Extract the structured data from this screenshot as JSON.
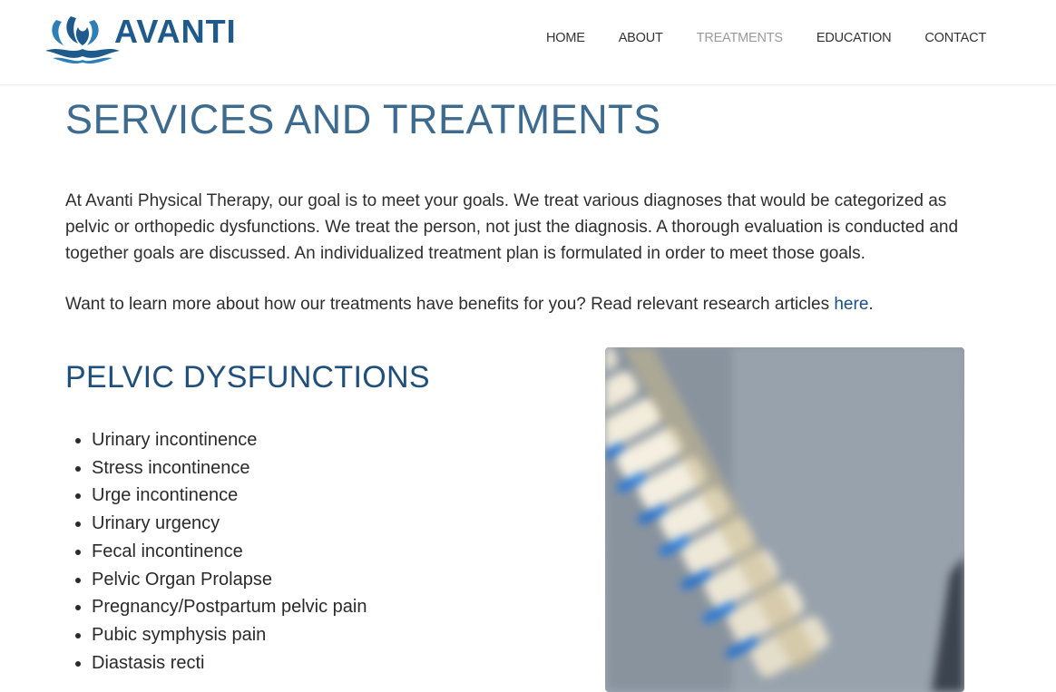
{
  "brand": {
    "name": "AVANTI"
  },
  "nav": {
    "items": [
      {
        "label": "HOME",
        "active": false
      },
      {
        "label": "ABOUT",
        "active": false
      },
      {
        "label": "TREATMENTS",
        "active": true
      },
      {
        "label": "EDUCATION",
        "active": false
      },
      {
        "label": "CONTACT",
        "active": false
      }
    ]
  },
  "page": {
    "title": "SERVICES AND TREATMENTS",
    "intro": "At Avanti Physical Therapy, our goal is to meet your goals. We treat various diagnoses that would be categorized as pelvic or orthopedic dysfunctions. We treat the person, not just the diagnosis. A thorough evaluation is conducted and together goals are discussed. An individualized treatment plan is formulated in order to meet those goals.",
    "research_text": "Want to learn more about how our treatments have benefits for you? Read relevant research articles ",
    "research_link": "here",
    "research_end": "."
  },
  "pelvic": {
    "title": "PELVIC DYSFUNCTIONS",
    "items": [
      "Urinary incontinence",
      "Stress incontinence",
      "Urge incontinence",
      "Urinary urgency",
      "Fecal incontinence",
      "Pelvic Organ Prolapse",
      "Pregnancy/Postpartum pelvic pain",
      "Pubic symphysis pain",
      "Diastasis recti"
    ]
  },
  "image": {
    "subject": "spine-model-photo"
  },
  "colors": {
    "brand": "#1e5a8c",
    "title": "#3d6a8f",
    "section_title": "#1f4f7c",
    "link": "#1a4f85",
    "nav_active": "#9a9a9a"
  }
}
